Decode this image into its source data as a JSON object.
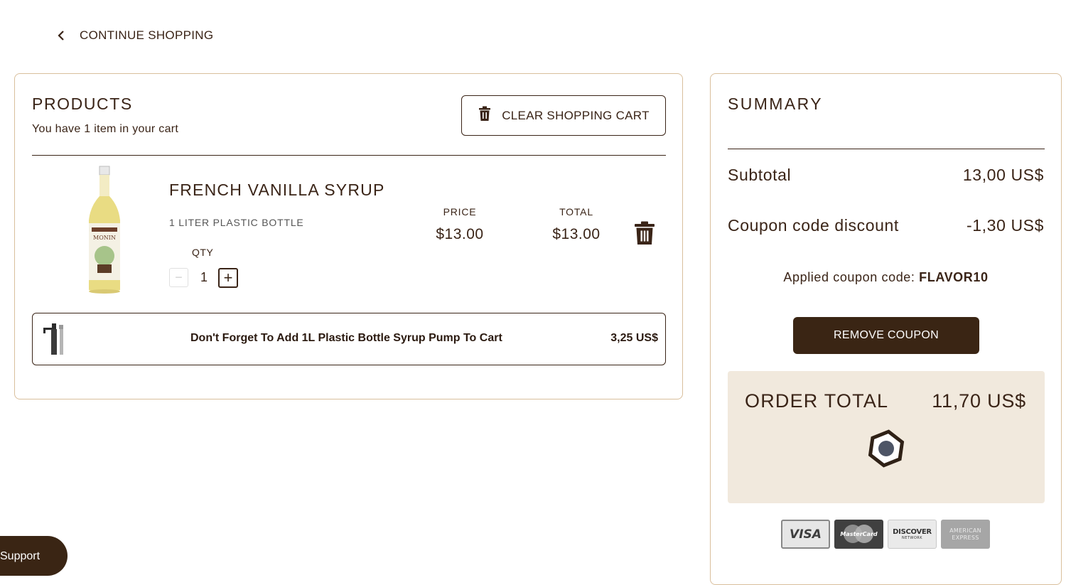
{
  "nav": {
    "continue_label": "CONTINUE SHOPPING"
  },
  "products": {
    "title": "PRODUCTS",
    "subtitle": "You have 1 item in your cart",
    "clear_label": "CLEAR SHOPPING CART",
    "items": [
      {
        "name": "FRENCH VANILLA SYRUP",
        "variant": "1 LITER PLASTIC BOTTLE",
        "qty_label": "QTY",
        "qty": "1",
        "price_label": "PRICE",
        "price": "$13.00",
        "total_label": "TOTAL",
        "total": "$13.00",
        "image_icon": "syrup-bottle"
      }
    ],
    "upsell": {
      "text": "Don't Forget To Add 1L Plastic Bottle Syrup Pump To Cart",
      "price": "3,25 US$",
      "image_icon": "syrup-pump"
    }
  },
  "summary": {
    "title": "SUMMARY",
    "subtotal_label": "Subtotal",
    "subtotal_value": "13,00 US$",
    "discount_label": "Coupon code discount",
    "discount_value": "-1,30 US$",
    "applied_prefix": "Applied coupon code:",
    "coupon_code": "FLAVOR10",
    "remove_label": "REMOVE COUPON",
    "order_total_label": "ORDER TOTAL",
    "order_total_value": "11,70 US$",
    "payment_cards": [
      {
        "name": "visa",
        "text": "VISA"
      },
      {
        "name": "mastercard",
        "text": "MasterCard"
      },
      {
        "name": "discover",
        "text": "DISCOVER",
        "sub": "NETWORK"
      },
      {
        "name": "amex",
        "text": "AMERICAN",
        "sub": "EXPRESS"
      }
    ]
  },
  "support": {
    "label": "Support"
  },
  "colors": {
    "brand_dark": "#3a2514",
    "panel_border": "#d9bf9c",
    "order_box_bg": "#f1e9dd"
  }
}
